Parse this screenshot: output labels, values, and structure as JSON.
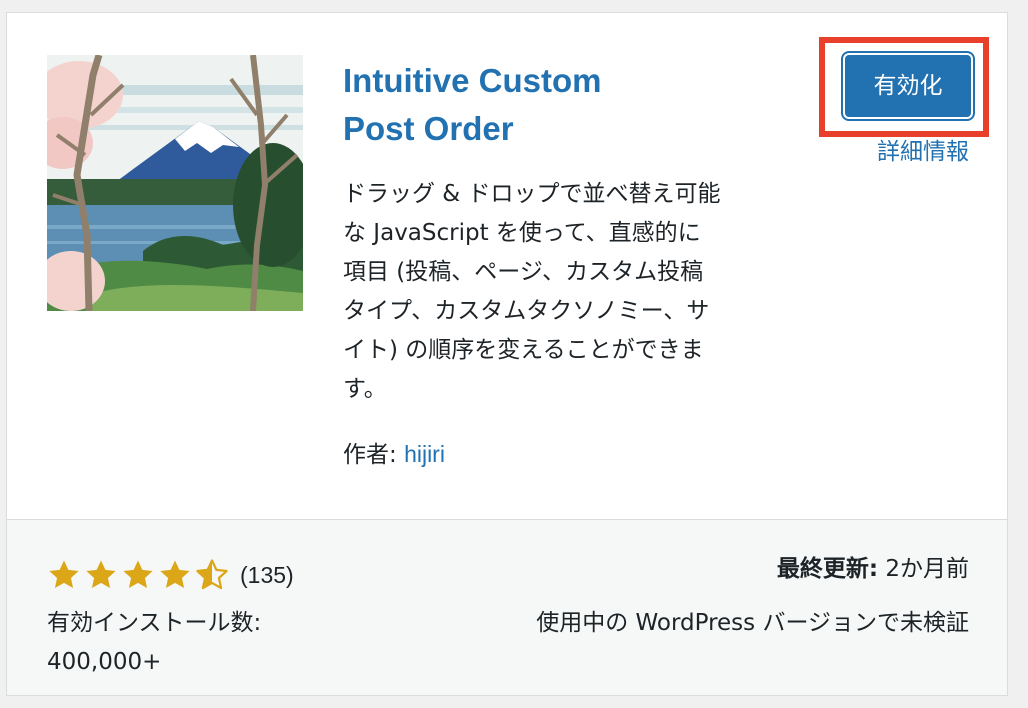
{
  "plugin": {
    "title": "Intuitive Custom Post Order",
    "description": "ドラッグ & ドロップで並べ替え可能な JavaScript を使って、直感的に項目 (投稿、ページ、カスタム投稿タイプ、カスタムタクソノミー、サイト) の順序を変えることができます。",
    "author_label": "作者:",
    "author_name": "hijiri",
    "thumbnail_icon": "mount-fuji-ukiyoe-illustration"
  },
  "actions": {
    "activate_label": "有効化",
    "details_label": "詳細情報"
  },
  "stats": {
    "rating_stars": 4.5,
    "rating_count": "(135)",
    "installs_label": "有効インストール数:",
    "installs_value": "400,000+",
    "last_updated_label": "最終更新:",
    "last_updated_value": "2か月前",
    "compat_text": "使用中の WordPress バージョンで未検証"
  },
  "colors": {
    "accent": "#2271b1",
    "highlight_box": "#e8402a",
    "star": "#dba617",
    "text": "#1d2327",
    "footer_bg": "#f6f7f7"
  }
}
